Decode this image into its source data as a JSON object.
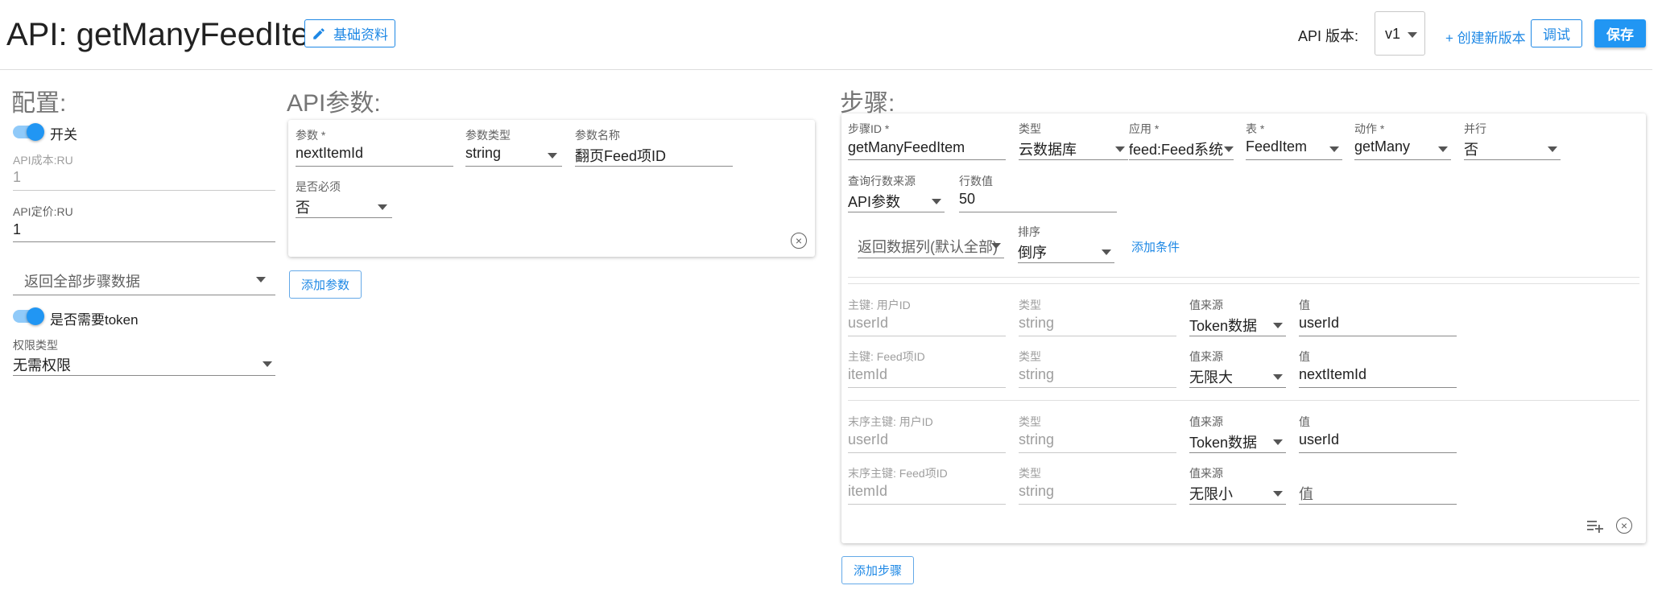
{
  "header": {
    "title": "API: getManyFeedItem",
    "basic_info_label": "基础资料",
    "version_label": "API 版本:",
    "version_value": "v1",
    "create_version_label": "+ 创建新版本",
    "debug_label": "调试",
    "save_label": "保存"
  },
  "config": {
    "title": "配置:",
    "switch_label": "开关",
    "api_cost_label": "API成本:RU",
    "api_cost_value": "1",
    "api_price_label": "API定价:RU",
    "api_price_value": "1",
    "return_steps_placeholder": "返回全部步骤数据",
    "token_label": "是否需要token",
    "permission_label": "权限类型",
    "permission_value": "无需权限"
  },
  "params": {
    "title": "API参数:",
    "param_label": "参数 *",
    "param_value": "nextItemId",
    "type_label": "参数类型",
    "type_value": "string",
    "name_label": "参数名称",
    "name_value": "翻页Feed项ID",
    "required_label": "是否必须",
    "required_value": "否",
    "add_label": "添加参数"
  },
  "steps": {
    "title": "步骤:",
    "row1": {
      "step_id_label": "步骤ID *",
      "step_id_value": "getManyFeedItem",
      "type_label": "类型",
      "type_value": "云数据库",
      "app_label": "应用 *",
      "app_value": "feed:Feed系统",
      "table_label": "表 *",
      "table_value": "FeedItem",
      "action_label": "动作 *",
      "action_value": "getMany",
      "parallel_label": "并行",
      "parallel_value": "否"
    },
    "row2": {
      "row_source_label": "查询行数来源",
      "row_source_value": "API参数",
      "row_count_label": "行数值",
      "row_count_value": "50"
    },
    "row3": {
      "return_cols_placeholder": "返回数据列(默认全部)",
      "sort_label": "排序",
      "sort_value": "倒序",
      "add_condition_label": "添加条件"
    },
    "keys": [
      {
        "key_label": "主键: 用户ID",
        "key_value": "userId",
        "type_label": "类型",
        "type_value": "string",
        "source_label": "值来源",
        "source_value": "Token数据",
        "value_label": "值",
        "value_value": "userId"
      },
      {
        "key_label": "主键: Feed项ID",
        "key_value": "itemId",
        "type_label": "类型",
        "type_value": "string",
        "source_label": "值来源",
        "source_value": "无限大",
        "value_label": "值",
        "value_value": "nextItemId"
      },
      {
        "key_label": "末序主键: 用户ID",
        "key_value": "userId",
        "type_label": "类型",
        "type_value": "string",
        "source_label": "值来源",
        "source_value": "Token数据",
        "value_label": "值",
        "value_value": "userId"
      },
      {
        "key_label": "末序主键: Feed项ID",
        "key_value": "itemId",
        "type_label": "类型",
        "type_value": "string",
        "source_label": "值来源",
        "source_value": "无限小",
        "value_label": "",
        "value_value": "值"
      }
    ],
    "add_step_label": "添加步骤"
  },
  "colors": {
    "accent": "#2196f3",
    "accent_light": "#90caf9"
  }
}
